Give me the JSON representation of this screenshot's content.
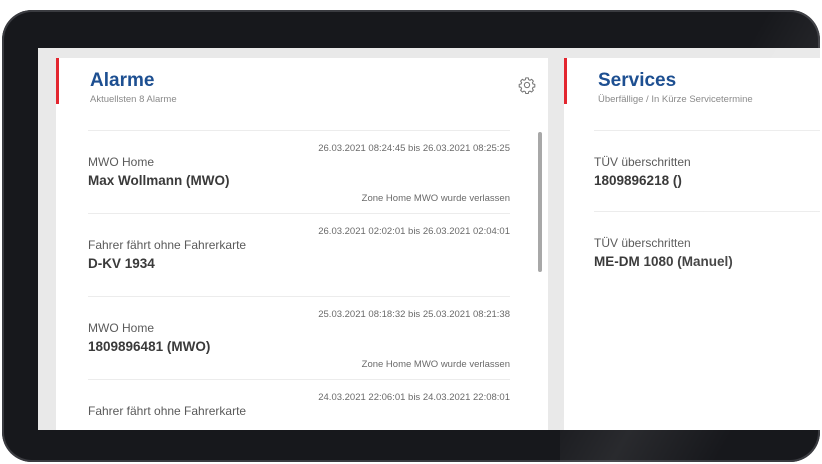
{
  "alarms": {
    "title": "Alarme",
    "subtitle": "Aktuellsten 8 Alarme",
    "items": [
      {
        "type": "MWO Home",
        "name": "Max Wollmann (MWO)",
        "time": "26.03.2021 08:24:45 bis 26.03.2021 08:25:25",
        "note": "Zone Home MWO wurde verlassen"
      },
      {
        "type": "Fahrer fährt ohne Fahrerkarte",
        "name": "D-KV 1934",
        "time": "26.03.2021 02:02:01 bis 26.03.2021 02:04:01",
        "note": ""
      },
      {
        "type": "MWO Home",
        "name": "1809896481 (MWO)",
        "time": "25.03.2021 08:18:32 bis 25.03.2021 08:21:38",
        "note": "Zone Home MWO wurde verlassen"
      },
      {
        "type": "Fahrer fährt ohne Fahrerkarte",
        "name": "",
        "time": "24.03.2021 22:06:01 bis 24.03.2021 22:08:01",
        "note": ""
      }
    ]
  },
  "services": {
    "title": "Services",
    "subtitle": "Überfällige / In Kürze Servicetermine",
    "items": [
      {
        "type": "TÜV überschritten",
        "name": "1809896218 ()"
      },
      {
        "type": "TÜV überschritten",
        "name": "ME-DM 1080 (Manuel)"
      }
    ]
  },
  "colors": {
    "accent": "#e3262f",
    "title": "#1d4f91",
    "bezel": "#17181c"
  },
  "icons": {
    "settings": "gear-icon"
  }
}
